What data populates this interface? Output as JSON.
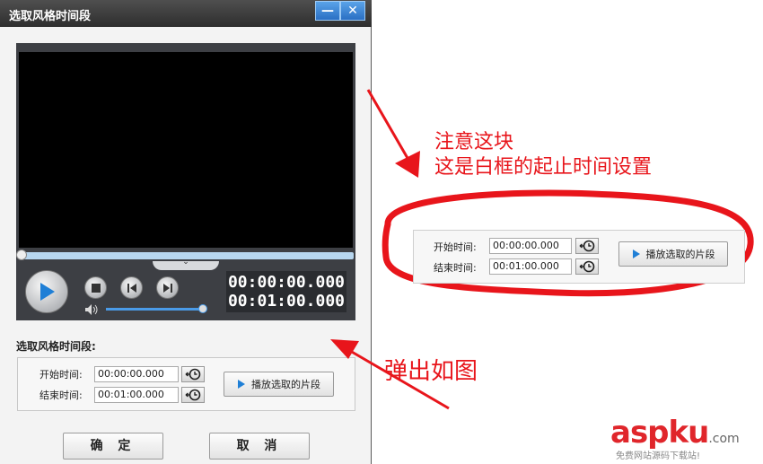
{
  "dialog": {
    "title": "选取风格时间段",
    "minimize_label": "—",
    "close_label": "✕"
  },
  "player": {
    "time_start": "00:00:00.000",
    "time_end": "00:01:00.000",
    "handle_glyph": "⌄",
    "accent_color": "#4a9be8"
  },
  "range": {
    "section_label": "选取风格时间段:",
    "start_label": "开始时间:",
    "start_value": "00:00:00.000",
    "end_label": "结束时间:",
    "end_value": "00:01:00.000",
    "play_selection_label": "播放选取的片段"
  },
  "buttons": {
    "ok_label": "确 定",
    "cancel_label": "取 消"
  },
  "annotations": {
    "note_line1": "注意这块",
    "note_line2": "这是白框的起止时间设置",
    "note_popup": "弹出如图",
    "color": "#e8151b"
  },
  "zoom_panel": {
    "start_label": "开始时间:",
    "start_value": "00:00:00.000",
    "end_label": "结束时间:",
    "end_value": "00:01:00.000",
    "play_selection_label": "播放选取的片段"
  },
  "watermark": {
    "brand": "aspku",
    "suffix": ".com",
    "tagline": "免费网站源码下载站!"
  }
}
